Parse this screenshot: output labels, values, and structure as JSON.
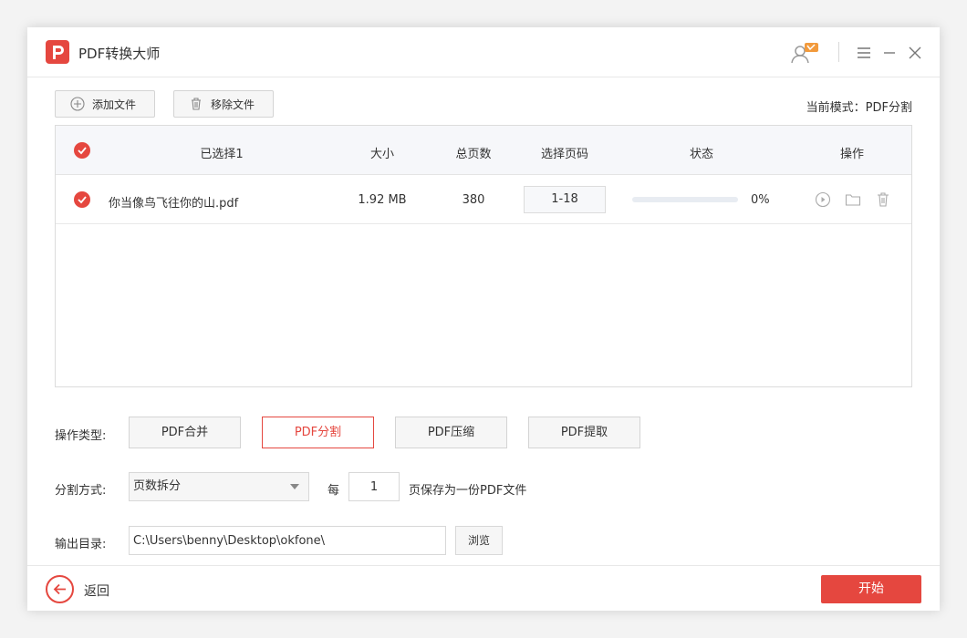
{
  "app": {
    "title": "PDF转换大师"
  },
  "toolbar": {
    "add_file": "添加文件",
    "remove_file": "移除文件",
    "mode_text": "当前模式：PDF分割"
  },
  "table": {
    "headers": {
      "selected": "已选择1",
      "size": "大小",
      "pages": "总页数",
      "page_range": "选择页码",
      "status": "状态",
      "actions": "操作"
    },
    "rows": [
      {
        "name": "你当像鸟飞往你的山.pdf",
        "size": "1.92 MB",
        "pages": "380",
        "page_range": "1-18",
        "progress_text": "0%",
        "progress": 0
      }
    ]
  },
  "operation": {
    "label": "操作类型:",
    "buttons": [
      "PDF合并",
      "PDF分割",
      "PDF压缩",
      "PDF提取"
    ],
    "active": "PDF分割"
  },
  "split": {
    "label": "分割方式:",
    "method": "页数拆分",
    "every": "每",
    "count": "1",
    "suffix": "页保存为一份PDF文件"
  },
  "output": {
    "label": "输出目录:",
    "path": "C:\\Users\\benny\\Desktop\\okfone\\",
    "browse": "浏览"
  },
  "footer": {
    "back": "返回",
    "start": "开始"
  },
  "colors": {
    "accent": "#e5473f"
  },
  "icons": [
    "pdf-logo-icon",
    "user-vip-icon",
    "menu-icon",
    "minimize-icon",
    "close-icon",
    "plus-circle-icon",
    "trash-icon",
    "check-circle-icon",
    "play-icon",
    "folder-icon",
    "arrow-left-icon",
    "dropdown-arrow-icon"
  ]
}
